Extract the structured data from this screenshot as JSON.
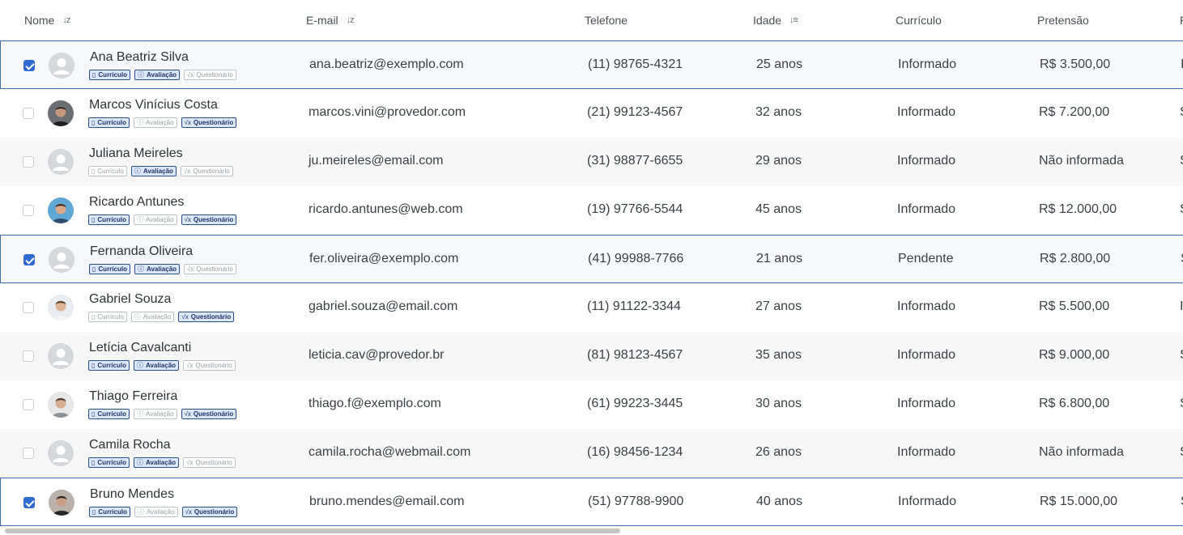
{
  "columns": [
    {
      "label": "Nome",
      "sort": "az"
    },
    {
      "label": "E-mail",
      "sort": "az"
    },
    {
      "label": "Telefone",
      "sort": ""
    },
    {
      "label": "Idade",
      "sort": "desc"
    },
    {
      "label": "Currículo",
      "sort": ""
    },
    {
      "label": "Pretensão",
      "sort": ""
    },
    {
      "label": "F",
      "sort": ""
    }
  ],
  "sort_icons": {
    "az": "↓z",
    "desc": "↓≡"
  },
  "badge_labels": {
    "curriculo": "Currículo",
    "avaliacao": "Avaliação",
    "questionario": "Questionário"
  },
  "badge_icons": {
    "curriculo": "document-icon",
    "avaliacao": "info-icon",
    "questionario": "sqrt-icon"
  },
  "rows": [
    {
      "name": "Ana Beatriz Silva",
      "email": "ana.beatriz@exemplo.com",
      "phone": "(11) 98765-4321",
      "age": "25 anos",
      "cv": "Informado",
      "salary": "R$ 3.500,00",
      "more": "I",
      "checked": true,
      "avatar": "placeholder",
      "badges": [
        true,
        true,
        false
      ]
    },
    {
      "name": "Marcos Vinícius Costa",
      "email": "marcos.vini@provedor.com",
      "phone": "(21) 99123-4567",
      "age": "32 anos",
      "cv": "Informado",
      "salary": "R$ 7.200,00",
      "more": "S",
      "checked": false,
      "avatar": "photo-dark",
      "badges": [
        true,
        false,
        true
      ]
    },
    {
      "name": "Juliana Meireles",
      "email": "ju.meireles@email.com",
      "phone": "(31) 98877-6655",
      "age": "29 anos",
      "cv": "Informado",
      "salary": "Não informada",
      "more": "S",
      "checked": false,
      "avatar": "placeholder",
      "badges": [
        false,
        true,
        false
      ]
    },
    {
      "name": "Ricardo Antunes",
      "email": "ricardo.antunes@web.com",
      "phone": "(19) 97766-5544",
      "age": "45 anos",
      "cv": "Informado",
      "salary": "R$ 12.000,00",
      "more": "S",
      "checked": false,
      "avatar": "photo-blue",
      "badges": [
        true,
        false,
        true
      ]
    },
    {
      "name": "Fernanda Oliveira",
      "email": "fer.oliveira@exemplo.com",
      "phone": "(41) 99988-7766",
      "age": "21 anos",
      "cv": "Pendente",
      "salary": "R$ 2.800,00",
      "more": "S",
      "checked": true,
      "avatar": "placeholder",
      "badges": [
        true,
        true,
        false
      ]
    },
    {
      "name": "Gabriel Souza",
      "email": "gabriel.souza@email.com",
      "phone": "(11) 91122-3344",
      "age": "27 anos",
      "cv": "Informado",
      "salary": "R$ 5.500,00",
      "more": "I",
      "checked": false,
      "avatar": "photo-light",
      "badges": [
        false,
        false,
        true
      ]
    },
    {
      "name": "Letícia Cavalcanti",
      "email": "leticia.cav@provedor.br",
      "phone": "(81) 98123-4567",
      "age": "35 anos",
      "cv": "Informado",
      "salary": "R$ 9.000,00",
      "more": "S",
      "checked": false,
      "avatar": "placeholder",
      "badges": [
        true,
        true,
        false
      ]
    },
    {
      "name": "Thiago Ferreira",
      "email": "thiago.f@exemplo.com",
      "phone": "(61) 99223-3445",
      "age": "30 anos",
      "cv": "Informado",
      "salary": "R$ 6.800,00",
      "more": "S",
      "checked": false,
      "avatar": "photo-grey",
      "badges": [
        true,
        false,
        true
      ]
    },
    {
      "name": "Camila Rocha",
      "email": "camila.rocha@webmail.com",
      "phone": "(16) 98456-1234",
      "age": "26 anos",
      "cv": "Informado",
      "salary": "Não informada",
      "more": "S",
      "checked": false,
      "avatar": "placeholder",
      "badges": [
        true,
        true,
        false
      ]
    },
    {
      "name": "Bruno Mendes",
      "email": "bruno.mendes@email.com",
      "phone": "(51) 97788-9900",
      "age": "40 anos",
      "cv": "Informado",
      "salary": "R$ 15.000,00",
      "more": "S",
      "checked": true,
      "avatar": "photo-warm",
      "badges": [
        true,
        false,
        true
      ]
    }
  ],
  "colors": {
    "accent": "#2f6bd0",
    "selected_border": "#3f6db3",
    "badge_on_bg": "#dbe7fb",
    "badge_on_text": "#1d3566"
  }
}
